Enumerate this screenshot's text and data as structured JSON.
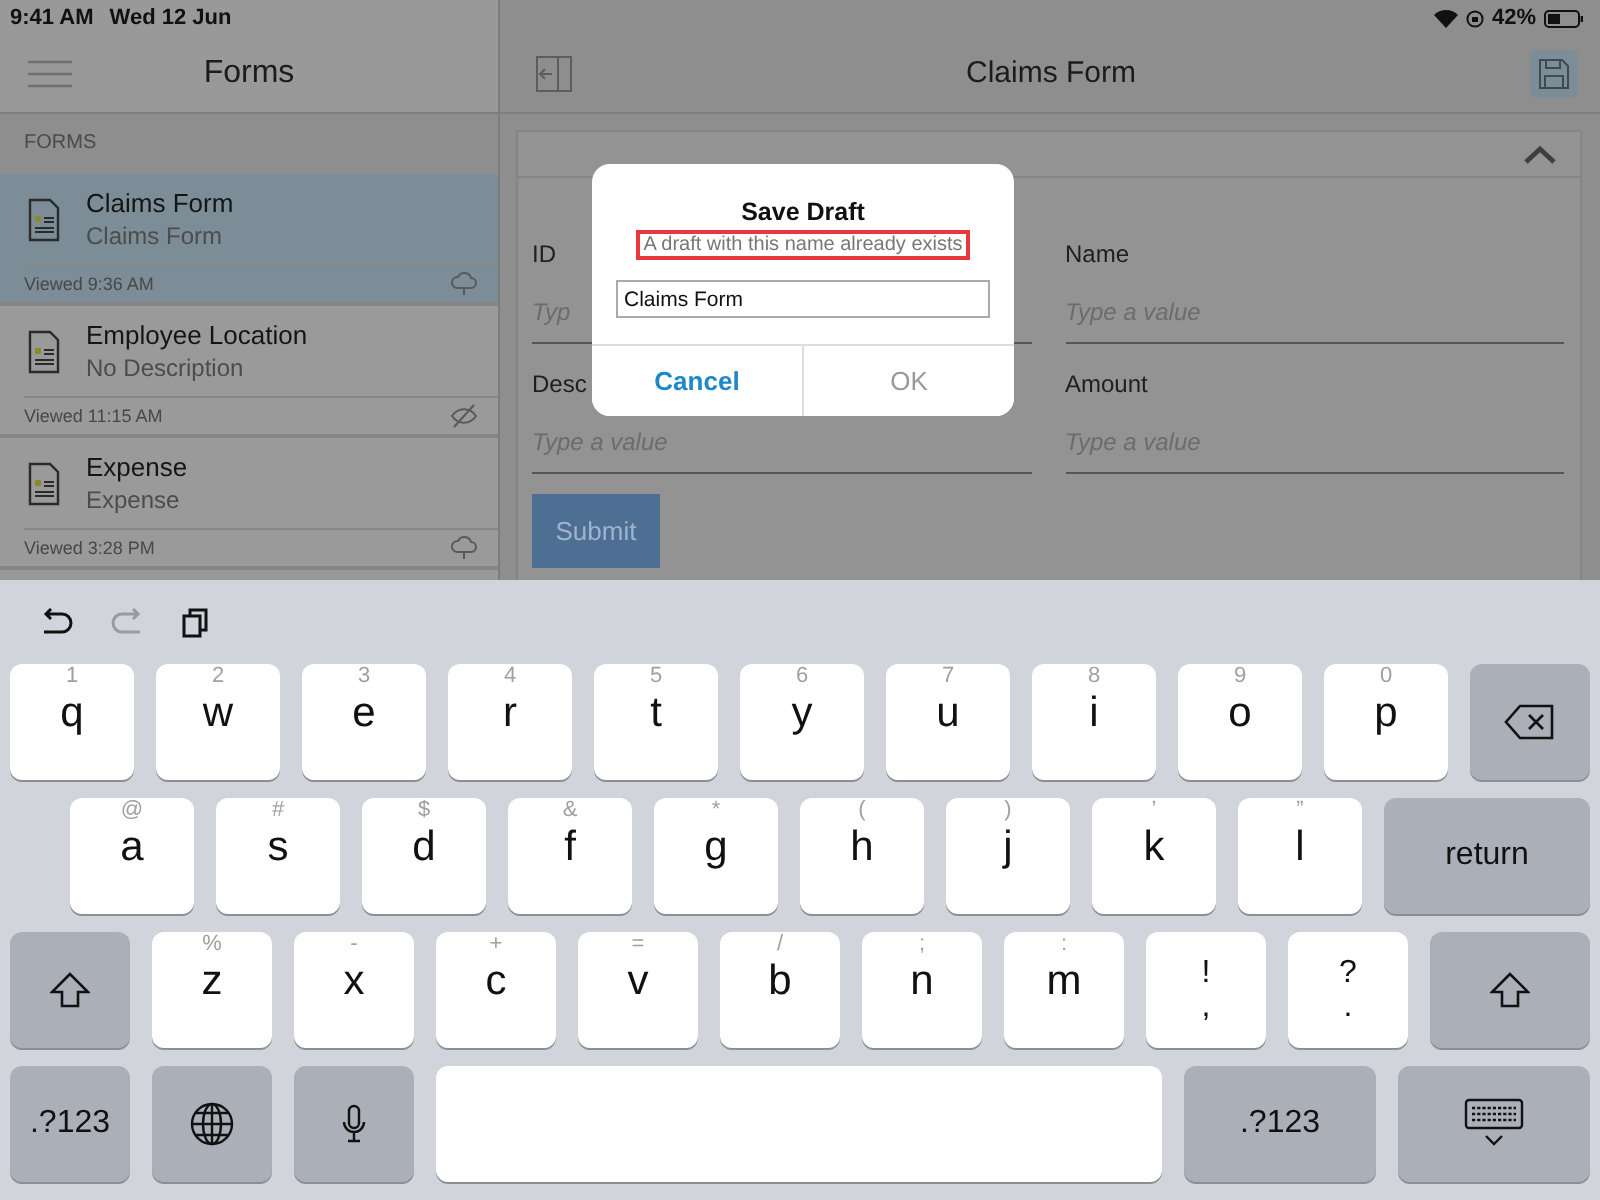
{
  "status_bar": {
    "time": "9:41 AM",
    "date": "Wed 12 Jun",
    "battery": "42%"
  },
  "sidebar": {
    "title": "Forms",
    "section": "FORMS",
    "items": [
      {
        "title": "Claims Form",
        "description": "Claims Form",
        "viewed": "Viewed 9:36 AM",
        "kind": "synced",
        "selected": true
      },
      {
        "title": "Employee Location",
        "description": "No Description",
        "viewed": "Viewed 11:15 AM",
        "kind": "hidden",
        "selected": false
      },
      {
        "title": "Expense",
        "description": "Expense",
        "viewed": "Viewed 3:28 PM",
        "kind": "synced",
        "selected": false
      }
    ]
  },
  "main": {
    "title": "Claims Form",
    "fields": [
      {
        "label": "ID",
        "placeholder": "Typ"
      },
      {
        "label": "Name",
        "placeholder": "Type a value"
      },
      {
        "label": "Desc",
        "placeholder": "Type a value"
      },
      {
        "label": "Amount",
        "placeholder": "Type a value"
      }
    ],
    "submit": "Submit"
  },
  "dialog": {
    "title": "Save Draft",
    "message": "A draft with this name already exists",
    "value": "Claims Form",
    "buttons": [
      {
        "label": "Cancel",
        "disabled": false
      },
      {
        "label": "OK",
        "disabled": true
      }
    ]
  },
  "keyboard": {
    "rows": [
      [
        {
          "kind": "letter",
          "main": "q",
          "alt": "1"
        },
        {
          "kind": "letter",
          "main": "w",
          "alt": "2"
        },
        {
          "kind": "letter",
          "main": "e",
          "alt": "3"
        },
        {
          "kind": "letter",
          "main": "r",
          "alt": "4"
        },
        {
          "kind": "letter",
          "main": "t",
          "alt": "5"
        },
        {
          "kind": "letter",
          "main": "y",
          "alt": "6"
        },
        {
          "kind": "letter",
          "main": "u",
          "alt": "7"
        },
        {
          "kind": "letter",
          "main": "i",
          "alt": "8"
        },
        {
          "kind": "letter",
          "main": "o",
          "alt": "9"
        },
        {
          "kind": "letter",
          "main": "p",
          "alt": "0"
        },
        {
          "kind": "delete"
        }
      ],
      [
        {
          "kind": "letter",
          "main": "a",
          "alt": "@"
        },
        {
          "kind": "letter",
          "main": "s",
          "alt": "#"
        },
        {
          "kind": "letter",
          "main": "d",
          "alt": "$"
        },
        {
          "kind": "letter",
          "main": "f",
          "alt": "&"
        },
        {
          "kind": "letter",
          "main": "g",
          "alt": "*"
        },
        {
          "kind": "letter",
          "main": "h",
          "alt": "("
        },
        {
          "kind": "letter",
          "main": "j",
          "alt": ")"
        },
        {
          "kind": "letter",
          "main": "k",
          "alt": "’"
        },
        {
          "kind": "letter",
          "main": "l",
          "alt": "”"
        },
        {
          "kind": "text",
          "main": "return"
        }
      ],
      [
        {
          "kind": "shift"
        },
        {
          "kind": "letter",
          "main": "z",
          "alt": "%"
        },
        {
          "kind": "letter",
          "main": "x",
          "alt": "-"
        },
        {
          "kind": "letter",
          "main": "c",
          "alt": "+"
        },
        {
          "kind": "letter",
          "main": "v",
          "alt": "="
        },
        {
          "kind": "letter",
          "main": "b",
          "alt": "/"
        },
        {
          "kind": "letter",
          "main": "n",
          "alt": ";"
        },
        {
          "kind": "letter",
          "main": "m",
          "alt": ":"
        },
        {
          "kind": "punct",
          "main": ",",
          "alt": "!"
        },
        {
          "kind": "punct",
          "main": ".",
          "alt": "?"
        },
        {
          "kind": "shift"
        }
      ],
      [
        {
          "kind": "text",
          "main": ".?123"
        },
        {
          "kind": "globe"
        },
        {
          "kind": "mic"
        },
        {
          "kind": "space"
        },
        {
          "kind": "text",
          "main": ".?123"
        },
        {
          "kind": "hide"
        }
      ]
    ]
  }
}
